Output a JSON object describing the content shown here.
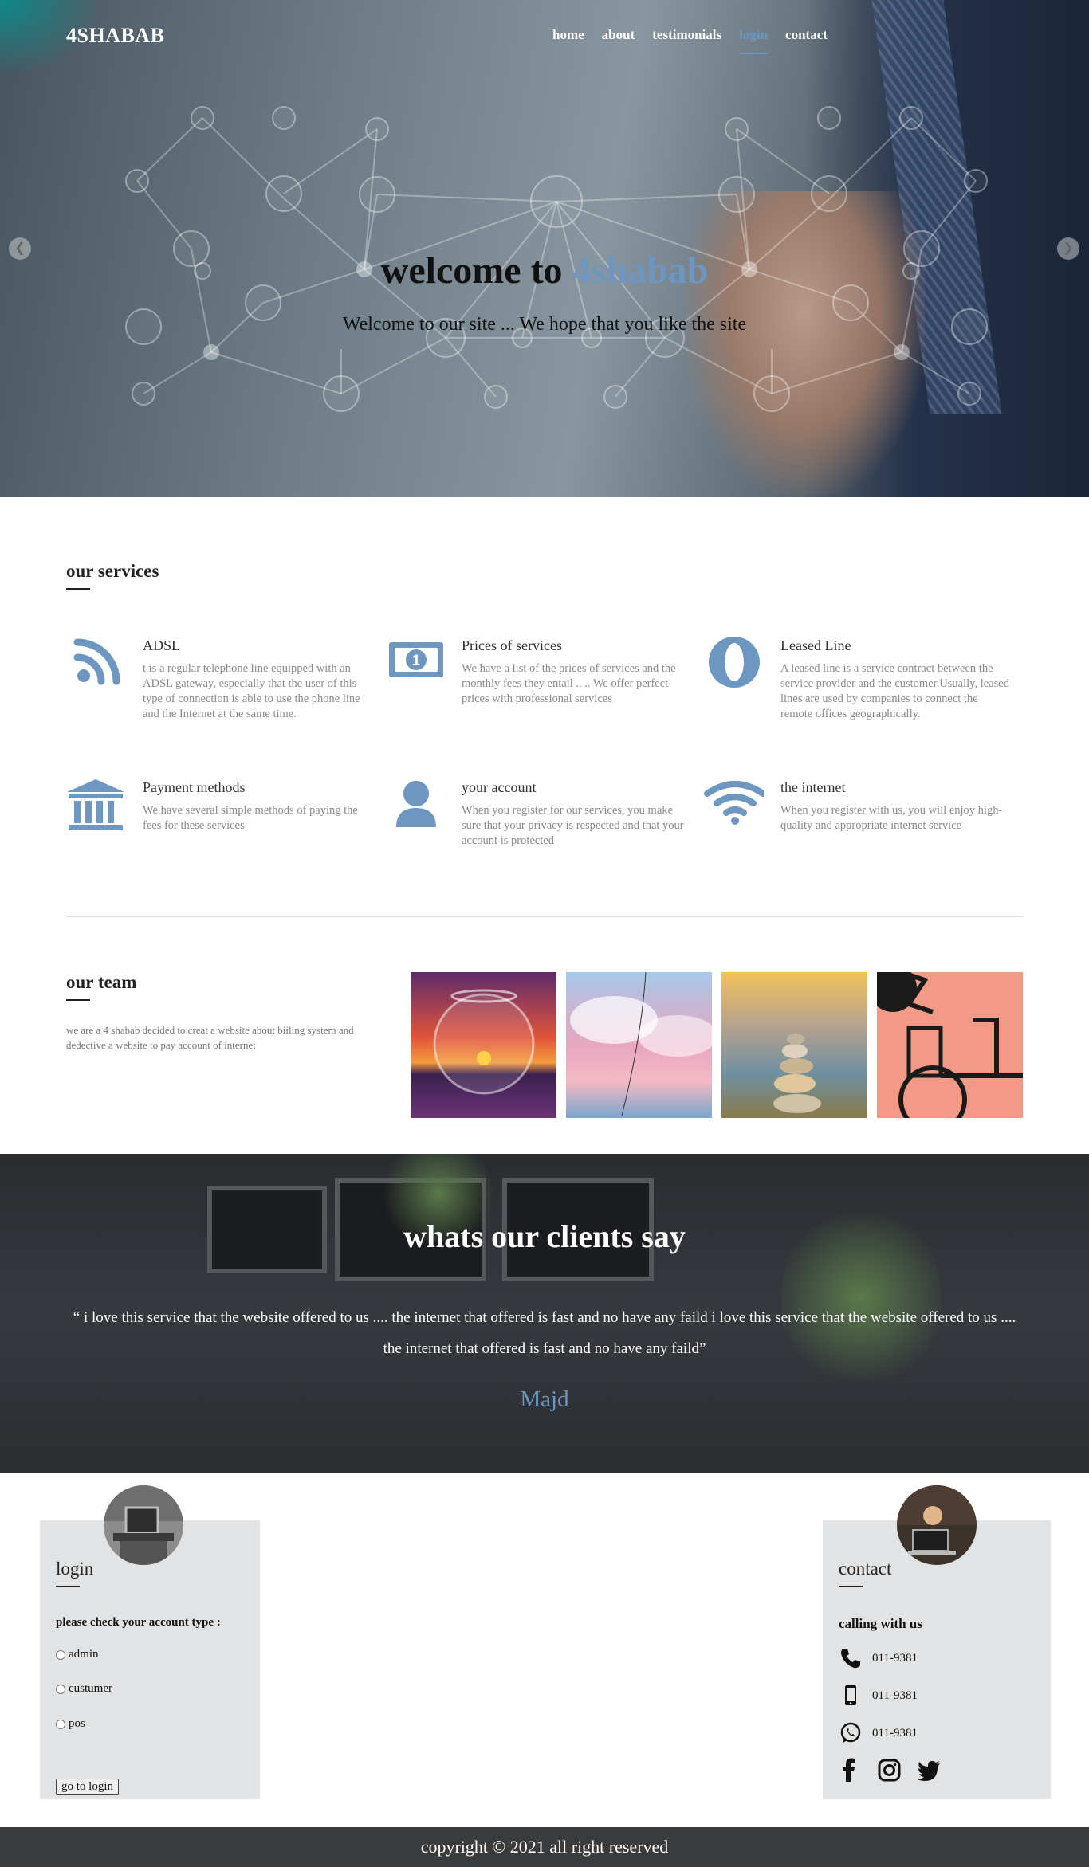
{
  "header": {
    "brand": "4SHABAB",
    "nav": [
      "home",
      "about",
      "testimonials",
      "login",
      "contact"
    ],
    "active_nav": "login"
  },
  "hero": {
    "title_prefix": "welcome to ",
    "title_accent": "4shabab",
    "subtitle": "Welcome to our site ... We hope that you like the site",
    "prev_icon": "chevron-left-icon",
    "next_icon": "chevron-right-icon"
  },
  "services": {
    "title": "our services",
    "items": [
      {
        "icon": "rss-icon",
        "title": "ADSL",
        "desc": "t is a regular telephone line equipped with an ADSL gateway, especially that the user of this type of connection is able to use the phone line and the Internet at the same time."
      },
      {
        "icon": "money-bill-icon",
        "title": "Prices of services",
        "desc": "We have a list of the prices of services and the monthly fees they entail .. .. We offer perfect prices with professional services"
      },
      {
        "icon": "opera-icon",
        "title": "Leased Line",
        "desc": "A leased line is a service contract between the service provider and the customer.Usually, leased lines are used by companies to connect the remote offices geographically."
      },
      {
        "icon": "bank-icon",
        "title": "Payment methods",
        "desc": "We have several simple methods of paying the fees for these services"
      },
      {
        "icon": "user-icon",
        "title": "your account",
        "desc": "When you register for our services, you make sure that your privacy is respected and that your account is protected"
      },
      {
        "icon": "wifi-icon",
        "title": "the internet",
        "desc": "When you register with us, you will enjoy high-quality and appropriate internet service"
      }
    ]
  },
  "team": {
    "title": "our team",
    "text": "we are a 4 shabab decided to creat a website about biiling system and dedective a website to pay account of internet"
  },
  "testimonial": {
    "title": "whats our clients say",
    "quote": "“ i love this service that the website offered to us .... the internet that offered is fast and no have any faild i love this service that the website offered to us .... the internet that offered is fast and no have any faild”",
    "author": "Majd"
  },
  "login": {
    "title": "login",
    "prompt": "please check your account type :",
    "options": [
      "admin",
      "custumer",
      "pos"
    ],
    "button": "go to login"
  },
  "contact": {
    "title": "contact",
    "heading": "calling with us",
    "rows": [
      {
        "icon": "phone-icon",
        "number": "011-9381"
      },
      {
        "icon": "mobile-icon",
        "number": "011-9381"
      },
      {
        "icon": "whatsapp-icon",
        "number": "011-9381"
      }
    ],
    "social": [
      "facebook-icon",
      "instagram-icon",
      "twitter-icon"
    ]
  },
  "footer": {
    "text": "copyright © 2021 all right reserved"
  },
  "colors": {
    "accent": "#6d97c0",
    "box": "#e1e3e4",
    "footer": "#3a3b3c"
  }
}
